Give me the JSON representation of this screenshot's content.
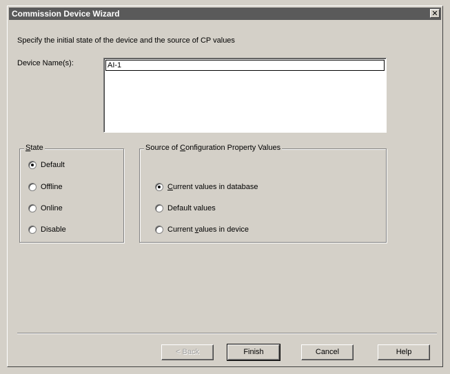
{
  "window": {
    "title": "Commission Device Wizard",
    "close_label": "✕"
  },
  "instruction": "Specify the initial state of the device and the source of CP values",
  "device_names": {
    "label": "Device Name(s):",
    "items": [
      "AI-1"
    ]
  },
  "state": {
    "legend_accel": "S",
    "legend_rest": "tate",
    "options": [
      {
        "label": "Default",
        "checked": true
      },
      {
        "label": "Offline",
        "checked": false
      },
      {
        "label": "Online",
        "checked": false
      },
      {
        "label": "Disable",
        "checked": false
      }
    ]
  },
  "source": {
    "legend_pre": "Source of ",
    "legend_accel": "C",
    "legend_rest": "onfiguration Property Values",
    "options": [
      {
        "pre": "",
        "accel": "C",
        "post": "urrent values in database",
        "checked": true
      },
      {
        "pre": "Default values",
        "accel": "",
        "post": "",
        "checked": false
      },
      {
        "pre": "Current ",
        "accel": "v",
        "post": "alues in device",
        "checked": false
      }
    ]
  },
  "buttons": {
    "back": "< Back",
    "finish": "Finish",
    "cancel": "Cancel",
    "help": "Help"
  }
}
